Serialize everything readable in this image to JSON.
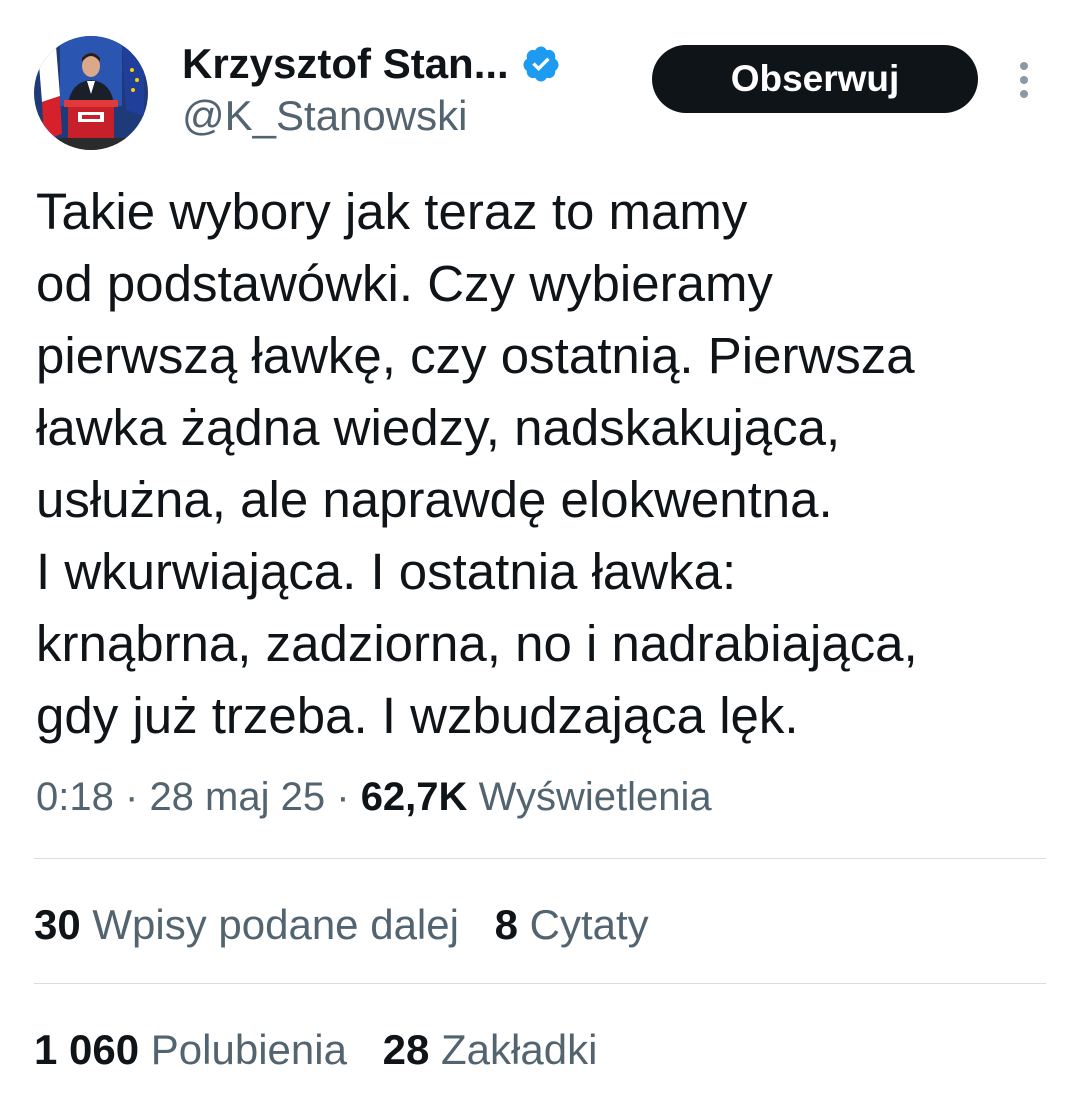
{
  "colors": {
    "text_primary": "#0f1419",
    "text_secondary": "#536471",
    "verified_blue": "#1d9bf0",
    "button_bg": "#0f1419",
    "divider": "#d7dde2"
  },
  "author": {
    "display_name": "Krzysztof Stan...",
    "handle": "@K_Stanowski",
    "verified": true,
    "avatar_icon": "profile-photo-speaker-at-podium"
  },
  "actions": {
    "follow_label": "Obserwuj",
    "more_icon": "more-vertical-icon"
  },
  "tweet": {
    "lines": [
      "Takie wybory jak teraz to mamy",
      "od podstawówki. Czy wybieramy",
      "pierwszą ławkę, czy ostatnią. Pierwsza",
      "ławka żądna wiedzy, nadskakująca,",
      "usłużna, ale naprawdę elokwentna.",
      "I wkurwiająca. I ostatnia ławka:",
      "krnąbrna, zadziorna, no i nadrabiająca,",
      "gdy już trzeba. I wzbudzająca lęk."
    ]
  },
  "meta": {
    "time": "0:18",
    "separator": "·",
    "date": "28 maj 25",
    "views_count": "62,7K",
    "views_label": "Wyświetlenia"
  },
  "stats": {
    "retweets_count": "30",
    "retweets_label": "Wpisy podane dalej",
    "quotes_count": "8",
    "quotes_label": "Cytaty",
    "likes_count": "1 060",
    "likes_label": "Polubienia",
    "bookmarks_count": "28",
    "bookmarks_label": "Zakładki"
  }
}
